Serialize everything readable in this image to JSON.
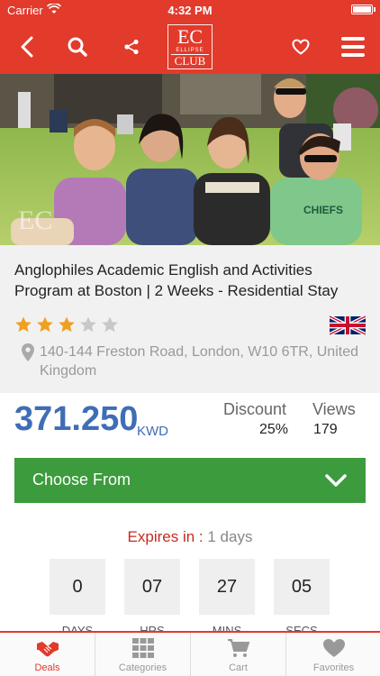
{
  "status_bar": {
    "carrier": "Carrier",
    "time": "4:32 PM"
  },
  "nav": {
    "logo_mark": "EC",
    "logo_small": "ELLIPSE",
    "logo_club": "CLUB",
    "icons": [
      "back-icon",
      "search-icon",
      "share-icon",
      "heart-icon",
      "menu-icon"
    ]
  },
  "deal": {
    "title": "Anglophiles Academic English and Activities Program at Boston | 2 Weeks - Residential Stay",
    "rating": 3,
    "rating_max": 5,
    "address": "140-144 Freston Road, London, W10 6TR, United Kingdom",
    "price": "371.250",
    "currency": "KWD",
    "discount_label": "Discount",
    "discount_value": "25%",
    "views_label": "Views",
    "views_value": "179",
    "choose_label": "Choose From",
    "expires_label": "Expires in :",
    "expires_value": "1 days"
  },
  "countdown": [
    {
      "value": "0",
      "label": "DAYS"
    },
    {
      "value": "07",
      "label": "HRS"
    },
    {
      "value": "27",
      "label": "MINS"
    },
    {
      "value": "05",
      "label": "SECS"
    }
  ],
  "tabs": [
    {
      "label": "Deals",
      "icon": "handshake-icon",
      "active": true
    },
    {
      "label": "Categories",
      "icon": "grid-icon",
      "active": false
    },
    {
      "label": "Cart",
      "icon": "cart-icon",
      "active": false
    },
    {
      "label": "Favorites",
      "icon": "heart-icon",
      "active": false
    }
  ],
  "colors": {
    "primary": "#e23a2b",
    "price": "#3f6db6",
    "button": "#3c9b3c",
    "star": "#f0a020"
  }
}
